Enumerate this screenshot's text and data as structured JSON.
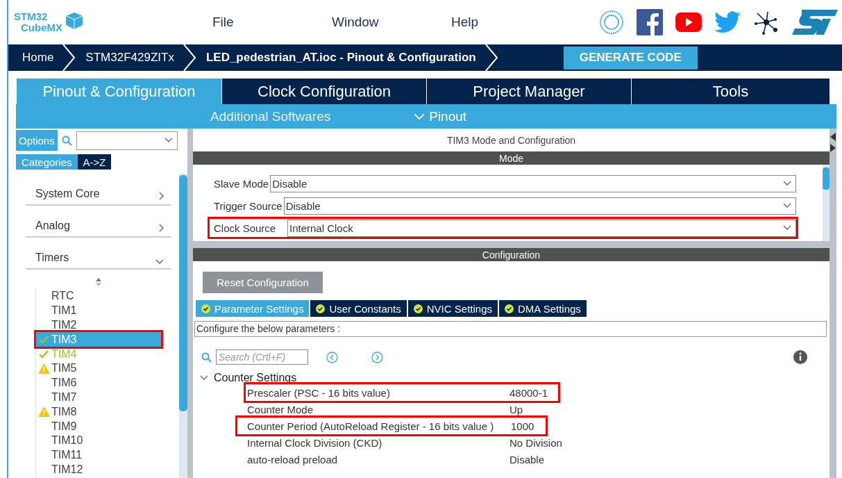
{
  "logo": {
    "line1": "STM32",
    "line2": "CubeMX"
  },
  "menu": [
    "File",
    "Window",
    "Help"
  ],
  "breadcrumbs": [
    {
      "label": "Home",
      "current": false
    },
    {
      "label": "STM32F429ZITx",
      "current": false
    },
    {
      "label": "LED_pedestrian_AT.ioc - Pinout & Configuration",
      "current": true
    }
  ],
  "generate_button": "GENERATE CODE",
  "main_tabs": [
    {
      "label": "Pinout & Configuration",
      "selected": true
    },
    {
      "label": "Clock Configuration",
      "selected": false
    },
    {
      "label": "Project Manager",
      "selected": false
    },
    {
      "label": "Tools",
      "selected": false
    }
  ],
  "sub_tabs": [
    {
      "label": "Additional Softwares",
      "kind": "plain"
    },
    {
      "label": "Pinout",
      "expanded": true,
      "kind": "menu"
    }
  ],
  "sidebar": {
    "options_button": "Options",
    "view_tabs": [
      {
        "label": "Categories",
        "selected": true
      },
      {
        "label": "A->Z",
        "selected": false
      }
    ],
    "categories": [
      {
        "label": "System Core",
        "expanded": false
      },
      {
        "label": "Analog",
        "expanded": false
      },
      {
        "label": "Timers",
        "expanded": true,
        "children": [
          {
            "label": "RTC",
            "kind": "plain",
            "selected": false,
            "highlighted": false
          },
          {
            "label": "TIM1",
            "kind": "plain",
            "selected": false,
            "highlighted": false
          },
          {
            "label": "TIM2",
            "kind": "plain",
            "selected": false,
            "highlighted": false
          },
          {
            "label": "TIM3",
            "kind": "ok",
            "selected": true,
            "highlighted": true
          },
          {
            "label": "TIM4",
            "kind": "ok",
            "selected": false,
            "highlighted": false
          },
          {
            "label": "TIM5",
            "kind": "warning",
            "selected": false,
            "highlighted": false
          },
          {
            "label": "TIM6",
            "kind": "plain",
            "selected": false,
            "highlighted": false
          },
          {
            "label": "TIM7",
            "kind": "plain",
            "selected": false,
            "highlighted": false
          },
          {
            "label": "TIM8",
            "kind": "warning",
            "selected": false,
            "highlighted": false
          },
          {
            "label": "TIM9",
            "kind": "plain",
            "selected": false,
            "highlighted": false
          },
          {
            "label": "TIM10",
            "kind": "plain",
            "selected": false,
            "highlighted": false
          },
          {
            "label": "TIM11",
            "kind": "plain",
            "selected": false,
            "highlighted": false
          },
          {
            "label": "TIM12",
            "kind": "plain",
            "selected": false,
            "highlighted": false
          }
        ]
      }
    ]
  },
  "panel": {
    "title": "TIM3 Mode and Configuration",
    "mode_header": "Mode",
    "mode_rows": [
      {
        "label": "Slave Mode",
        "value": "Disable",
        "highlighted": false
      },
      {
        "label": "Trigger Source",
        "value": "Disable",
        "highlighted": false
      },
      {
        "label": "Clock Source",
        "value": "Internal Clock",
        "highlighted": true
      }
    ],
    "config_header": "Configuration",
    "reset_button": "Reset Configuration",
    "config_tabs": [
      {
        "label": "Parameter Settings",
        "selected": true
      },
      {
        "label": "User Constants",
        "selected": false
      },
      {
        "label": "NVIC Settings",
        "selected": false
      },
      {
        "label": "DMA Settings",
        "selected": false
      }
    ],
    "description": "Configure the below parameters :",
    "search": {
      "placeholder": "Search (Crtl+F)"
    },
    "group": {
      "label": "Counter Settings",
      "expanded": true,
      "params": [
        {
          "name": "Prescaler (PSC - 16 bits value)",
          "value": "48000-1",
          "highlighted": true
        },
        {
          "name": "Counter Mode",
          "value": "Up",
          "highlighted": false
        },
        {
          "name": "Counter Period (AutoReload Register - 16 bits value )",
          "value": "1000",
          "highlighted": true
        },
        {
          "name": "Internal Clock Division (CKD)",
          "value": "No Division",
          "highlighted": false
        },
        {
          "name": "auto-reload preload",
          "value": "Disable",
          "highlighted": false
        }
      ]
    }
  }
}
